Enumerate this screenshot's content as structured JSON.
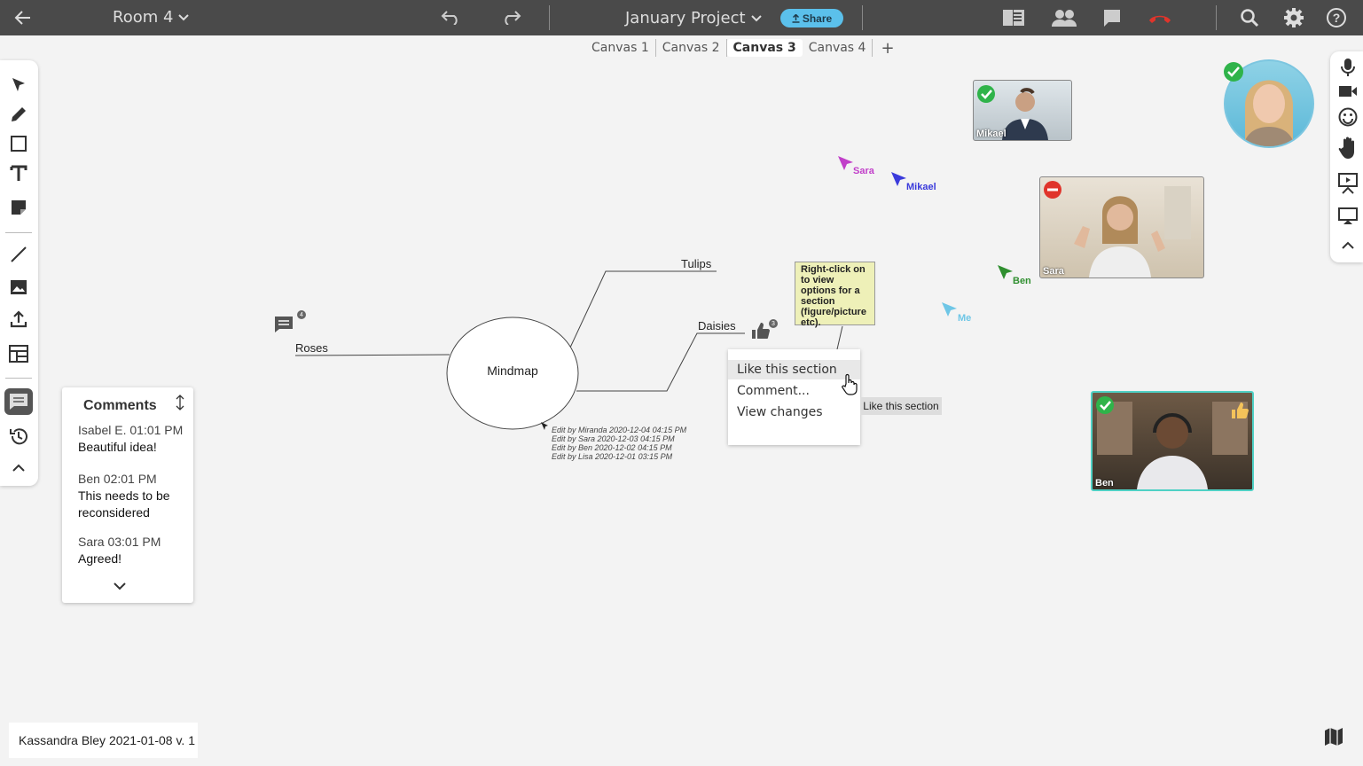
{
  "topbar": {
    "room": "Room 4",
    "project": "January Project",
    "share": "Share"
  },
  "tabs": [
    {
      "label": "Canvas 1",
      "active": false
    },
    {
      "label": "Canvas 2",
      "active": false
    },
    {
      "label": "Canvas 3",
      "active": true
    },
    {
      "label": "Canvas 4",
      "active": false
    }
  ],
  "tabs_add": "+",
  "mindmap": {
    "center": "Mindmap",
    "nodes": [
      "Tulips",
      "Daisies",
      "Roses"
    ],
    "comment_count": "4",
    "like_count": "3"
  },
  "note": "Right-click on to view options for a section (figure/picture etc).",
  "edits": [
    "Edit by Miranda 2020-12-04 04:15 PM",
    "Edit by Sara 2020-12-03 04:15 PM",
    "Edit by Ben 2020-12-02 04:15 PM",
    "Edit by Lisa 2020-12-01 03:15 PM"
  ],
  "context_menu": [
    "Like this section",
    "Comment...",
    "View changes"
  ],
  "tooltip": "Like this section",
  "cursors": [
    {
      "name": "Sara",
      "color": "#c13fc9"
    },
    {
      "name": "Mikael",
      "color": "#3a3adb"
    },
    {
      "name": "Ben",
      "color": "#2f8f2f"
    },
    {
      "name": "Me",
      "color": "#6ec6e6"
    }
  ],
  "videos": [
    {
      "name": "Mikael",
      "status": "check"
    },
    {
      "name": "Sara",
      "status": "busy"
    },
    {
      "name": "Ben",
      "status": "check"
    }
  ],
  "comments": {
    "title": "Comments",
    "items": [
      {
        "meta": "Isabel E. 01:01 PM",
        "text": "Beautiful idea!"
      },
      {
        "meta": "Ben 02:01 PM",
        "text": "This needs to be reconsidered"
      },
      {
        "meta": "Sara 03:01 PM",
        "text": "Agreed!"
      }
    ]
  },
  "footer": "Kassandra Bley 2021-01-08 v. 1",
  "colors": {
    "topbar": "#4a4a4a",
    "share": "#5bc0eb",
    "hangup": "#e0342b",
    "check": "#2fb34a",
    "busy": "#e0342b"
  }
}
